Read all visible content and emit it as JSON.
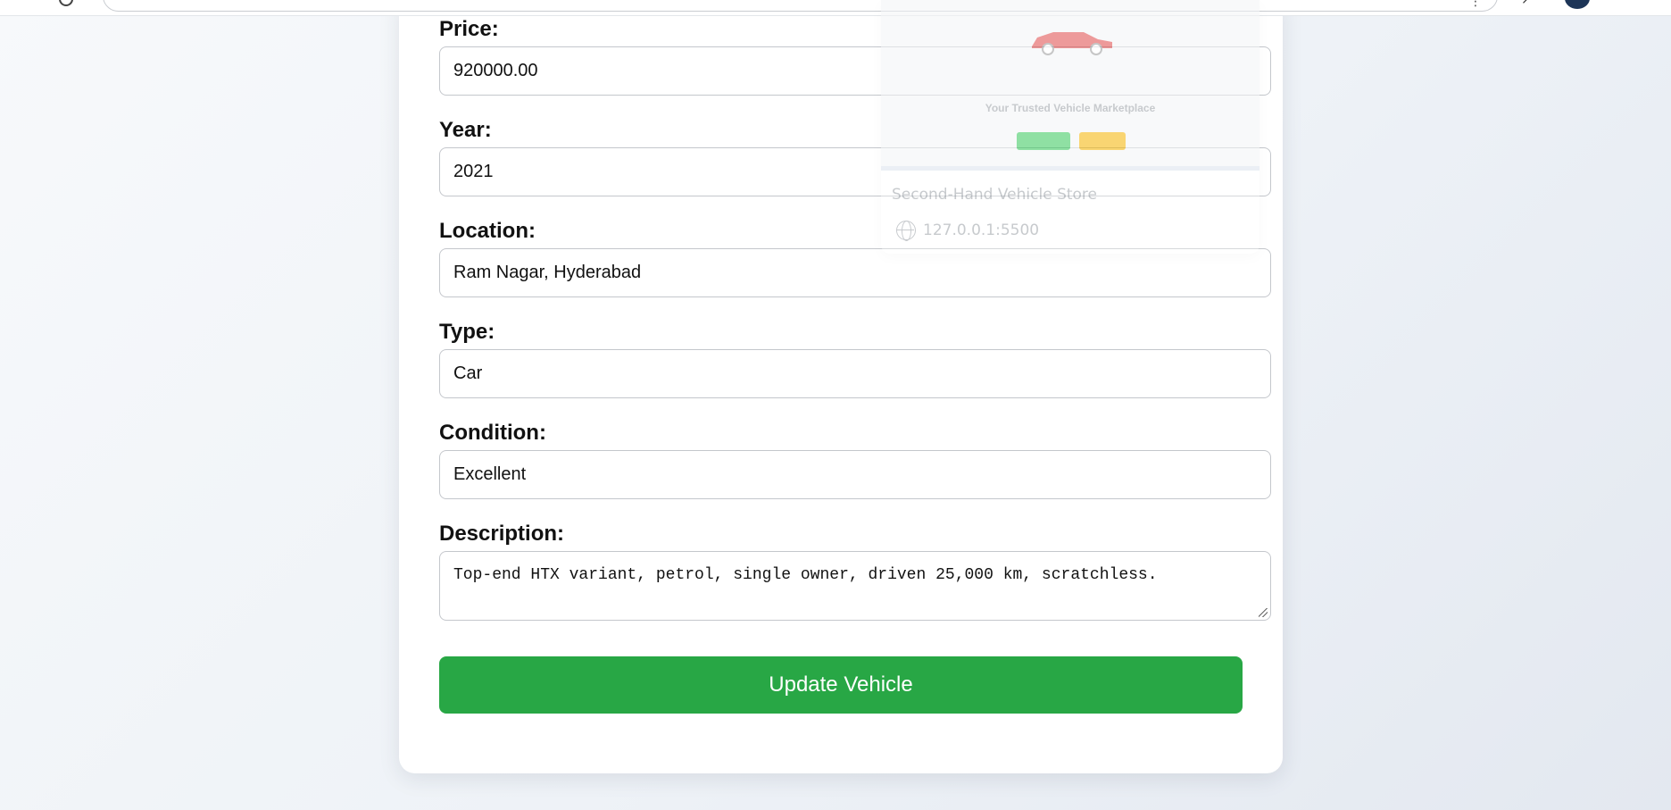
{
  "form": {
    "fields": [
      {
        "label": "Price:",
        "value": "920000.00"
      },
      {
        "label": "Year:",
        "value": "2021"
      },
      {
        "label": "Location:",
        "value": "Ram Nagar, Hyderabad"
      },
      {
        "label": "Type:",
        "value": "Car"
      },
      {
        "label": "Condition:",
        "value": "Excellent"
      }
    ],
    "description": {
      "label": "Description:",
      "value": "Top-end HTX variant, petrol, single owner, driven 25,000 km, scratchless."
    },
    "submit_label": "Update Vehicle"
  },
  "tab_preview": {
    "tagline": "Your Trusted Vehicle Marketplace",
    "page_title": "Second-Hand Vehicle Store",
    "url": "127.0.0.1:5500",
    "icon": "globe-icon"
  },
  "colors": {
    "primary_button": "#28a745",
    "background": "#eef2f7"
  }
}
